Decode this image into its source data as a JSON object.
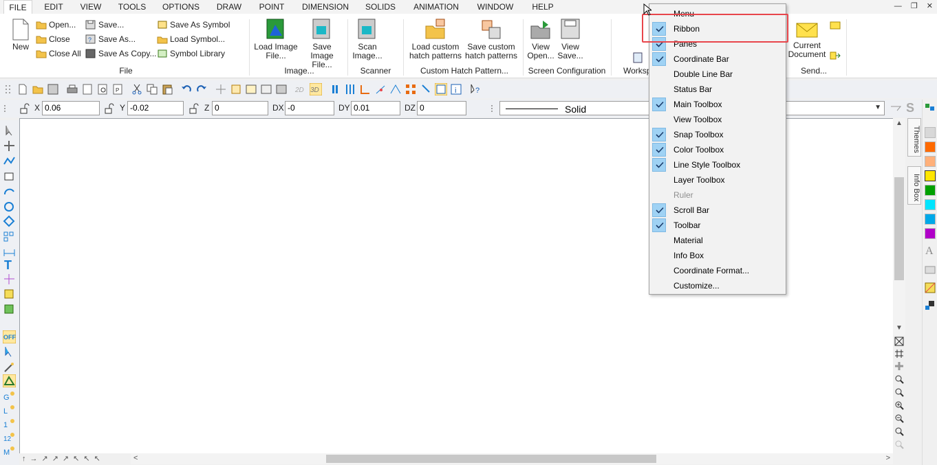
{
  "menubar": {
    "items": [
      "FILE",
      "EDIT",
      "VIEW",
      "TOOLS",
      "OPTIONS",
      "DRAW",
      "POINT",
      "DIMENSION",
      "SOLIDS",
      "ANIMATION",
      "WINDOW",
      "HELP"
    ],
    "active": "FILE"
  },
  "ribbon": {
    "file_group": {
      "label": "File",
      "new": "New",
      "open": "Open...",
      "close": "Close",
      "close_all": "Close All",
      "save": "Save...",
      "save_as": "Save As...",
      "save_as_copy": "Save As Copy...",
      "save_as_symbol": "Save As Symbol",
      "load_symbol": "Load Symbol...",
      "symbol_library": "Symbol Library"
    },
    "image_group": {
      "label": "Image...",
      "load_image_1": "Load Image",
      "load_image_2": "File...",
      "save_image_1": "Save Image",
      "save_image_2": "File..."
    },
    "scanner_group": {
      "label": "Scanner",
      "scan_1": "Scan",
      "scan_2": "Image..."
    },
    "hatch_group": {
      "label": "Custom Hatch Pattern...",
      "load_1": "Load custom",
      "load_2": "hatch patterns",
      "save_1": "Save custom",
      "save_2": "hatch patterns"
    },
    "screen_group": {
      "label": "Screen Configuration",
      "view_open_1": "View",
      "view_open_2": "Open...",
      "view_save_1": "View",
      "view_save_2": "Save..."
    },
    "workspace_label": "Worksp",
    "send_group": {
      "label": "Send...",
      "current_1": "Current",
      "current_2": "Document"
    }
  },
  "coordinate_bar": {
    "x_label": "X",
    "x_value": "0.06",
    "y_label": "Y",
    "y_value": "-0.02",
    "z_label": "Z",
    "z_value": "0",
    "dx_label": "DX",
    "dx_value": "-0",
    "dy_label": "DY",
    "dy_value": "0.01",
    "dz_label": "DZ",
    "dz_value": "0",
    "line_style": "Solid"
  },
  "side_tabs": {
    "themes": "Themes",
    "info_box": "Info Box"
  },
  "colors": {
    "swatches": [
      "#d8d8d8",
      "#ff6a00",
      "#ffb07a",
      "#ffe600",
      "#00a000",
      "#00e5ff",
      "#00a8e8",
      "#b000c8"
    ]
  },
  "context_menu": {
    "items": [
      {
        "label": "Menu",
        "checked": false,
        "disabled": false
      },
      {
        "label": "Ribbon",
        "checked": true,
        "disabled": false
      },
      {
        "label": "Panes",
        "checked": true,
        "disabled": false
      },
      {
        "label": "Coordinate Bar",
        "checked": true,
        "disabled": false
      },
      {
        "label": "Double Line Bar",
        "checked": false,
        "disabled": false
      },
      {
        "label": "Status Bar",
        "checked": false,
        "disabled": false
      },
      {
        "label": "Main Toolbox",
        "checked": true,
        "disabled": false
      },
      {
        "label": "View Toolbox",
        "checked": false,
        "disabled": false
      },
      {
        "label": "Snap Toolbox",
        "checked": true,
        "disabled": false
      },
      {
        "label": "Color Toolbox",
        "checked": true,
        "disabled": false
      },
      {
        "label": "Line Style Toolbox",
        "checked": true,
        "disabled": false
      },
      {
        "label": "Layer Toolbox",
        "checked": false,
        "disabled": false
      },
      {
        "label": "Ruler",
        "checked": false,
        "disabled": true
      },
      {
        "label": "Scroll Bar",
        "checked": true,
        "disabled": false
      },
      {
        "label": "Toolbar",
        "checked": true,
        "disabled": false
      },
      {
        "label": "Material",
        "checked": false,
        "disabled": false
      },
      {
        "label": "Info Box",
        "checked": false,
        "disabled": false
      },
      {
        "label": "Coordinate Format...",
        "checked": false,
        "disabled": false
      },
      {
        "label": "Customize...",
        "checked": false,
        "disabled": false
      }
    ]
  }
}
